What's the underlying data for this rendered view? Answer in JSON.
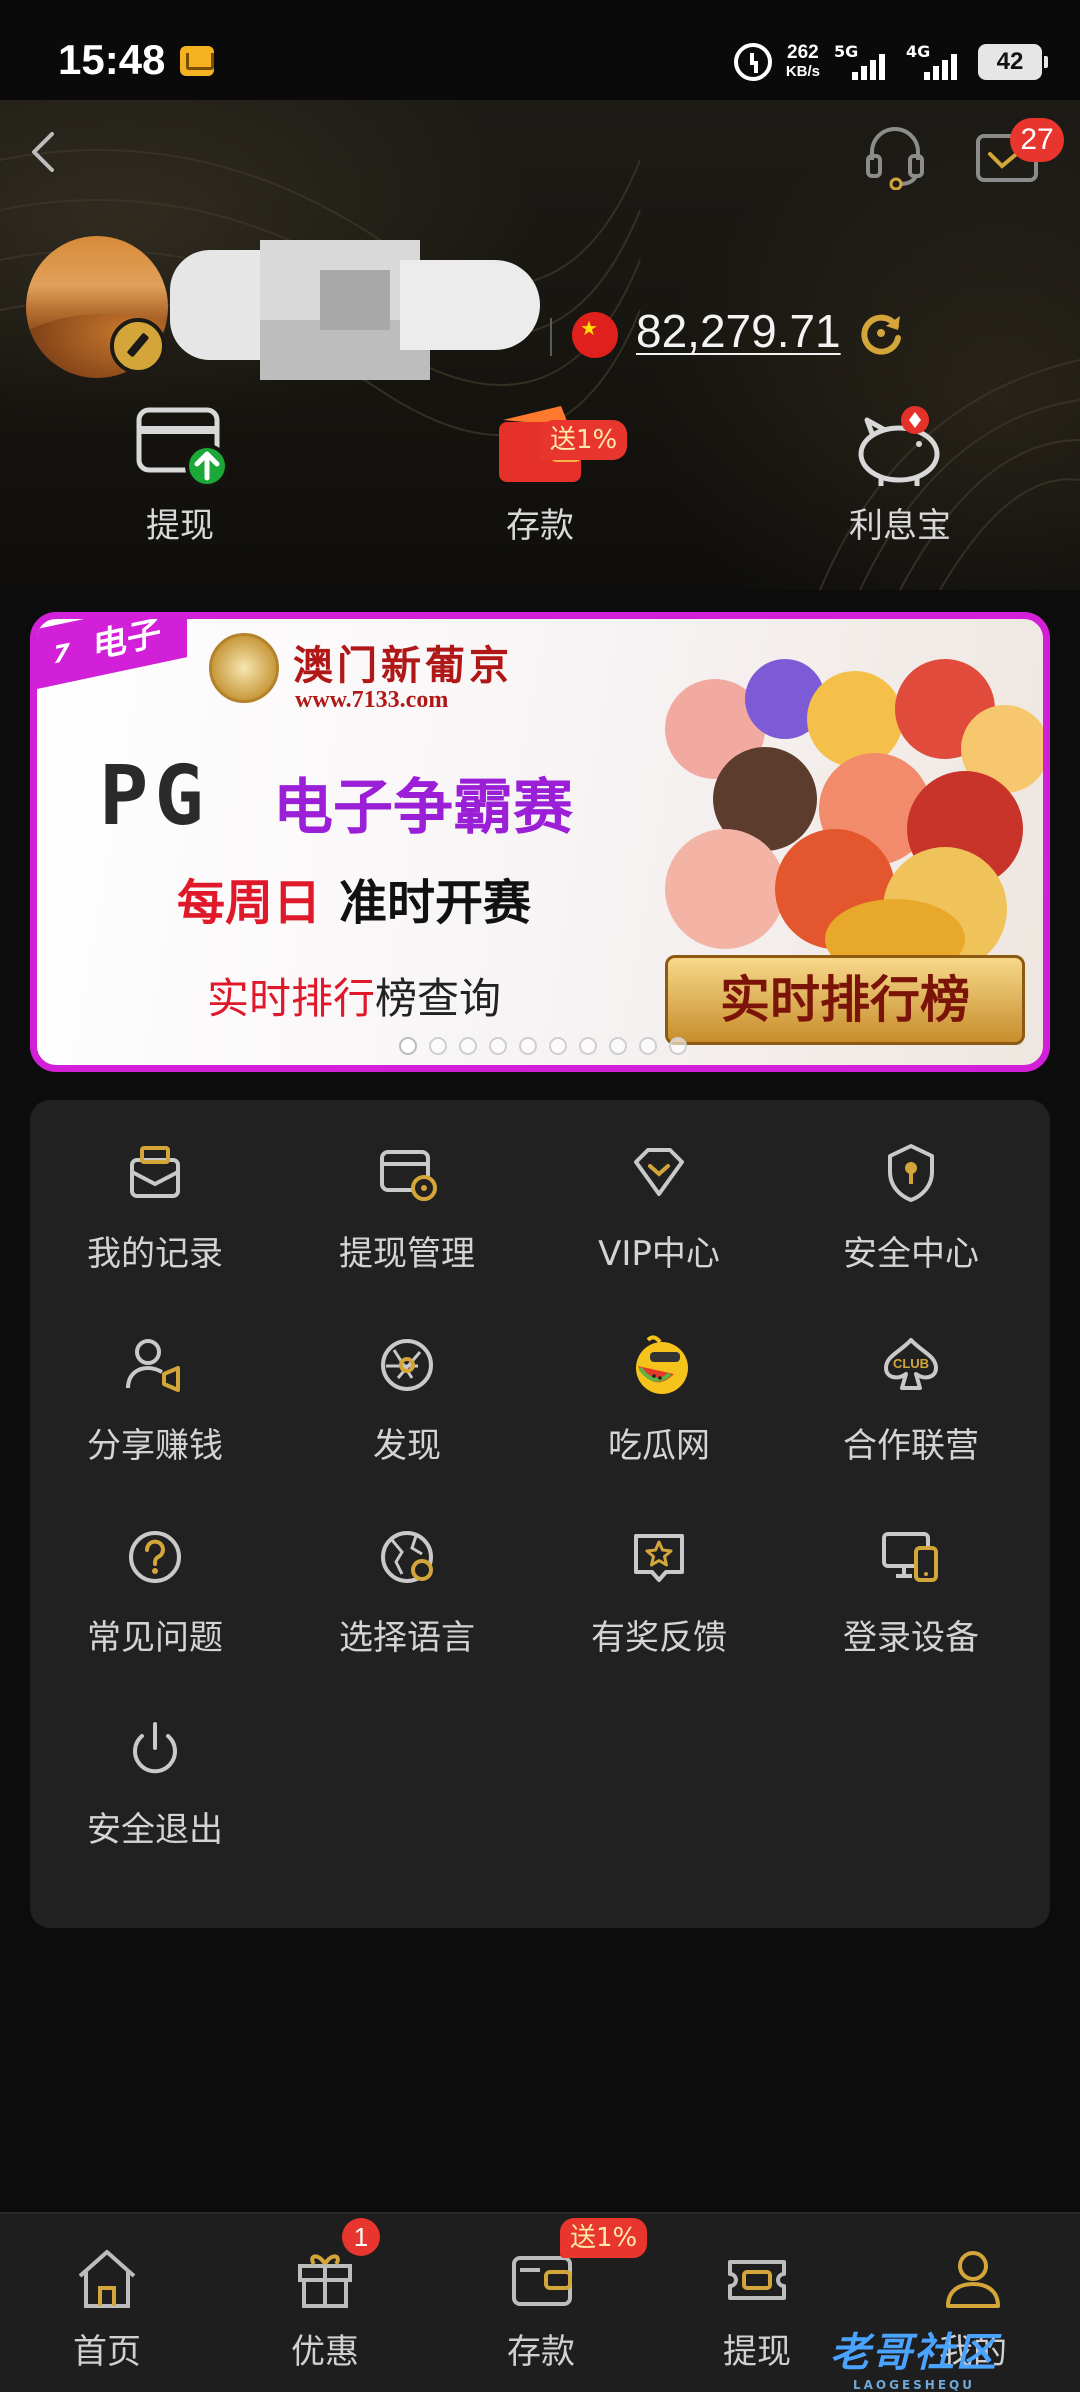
{
  "status_bar": {
    "time": "15:48",
    "speed_value": "262",
    "speed_unit": "KB/s",
    "net1": "5G",
    "net2": "4G",
    "battery": "42"
  },
  "header": {
    "message_badge": "27",
    "balance": "82,279.71"
  },
  "quick_actions": [
    {
      "label": "提现",
      "icon": "withdraw-card-icon"
    },
    {
      "label": "存款",
      "icon": "wallet-icon",
      "badge": "送1%"
    },
    {
      "label": "利息宝",
      "icon": "piggy-bank-icon"
    }
  ],
  "banner": {
    "tag": "电子",
    "tag_prefix": "7",
    "brand": "澳门新葡京",
    "url": "www.7133.com",
    "pg": "PG",
    "title": "电子争霸赛",
    "sub_red": "每周日",
    "sub_black": "准时开赛",
    "rank_red": "实时排行",
    "rank_black": "榜查询",
    "badge": "实时排行榜",
    "slides": 10,
    "active_slide": 0
  },
  "menu": [
    {
      "label": "我的记录",
      "icon": "records-icon"
    },
    {
      "label": "提现管理",
      "icon": "withdraw-manage-icon"
    },
    {
      "label": "VIP中心",
      "icon": "vip-icon"
    },
    {
      "label": "安全中心",
      "icon": "security-icon"
    },
    {
      "label": "分享赚钱",
      "icon": "share-earn-icon"
    },
    {
      "label": "发现",
      "icon": "discover-icon"
    },
    {
      "label": "吃瓜网",
      "icon": "melon-emoji-icon"
    },
    {
      "label": "合作联营",
      "icon": "club-icon"
    },
    {
      "label": "常见问题",
      "icon": "question-icon"
    },
    {
      "label": "选择语言",
      "icon": "language-icon"
    },
    {
      "label": "有奖反馈",
      "icon": "feedback-icon"
    },
    {
      "label": "登录设备",
      "icon": "devices-icon"
    },
    {
      "label": "安全退出",
      "icon": "power-icon"
    }
  ],
  "bottom_nav": [
    {
      "label": "首页",
      "icon": "home-icon"
    },
    {
      "label": "优惠",
      "icon": "gift-icon",
      "badge": "1"
    },
    {
      "label": "存款",
      "icon": "wallet-icon",
      "badge": "送1%"
    },
    {
      "label": "提现",
      "icon": "cash-icon"
    },
    {
      "label": "我的",
      "icon": "user-icon"
    }
  ],
  "watermark": {
    "text": "老哥社区",
    "sub": "LAOGESHEQU"
  },
  "colors": {
    "accent": "#d4a63a",
    "badge": "#e8352d",
    "banner_border": "#d21fd8"
  }
}
